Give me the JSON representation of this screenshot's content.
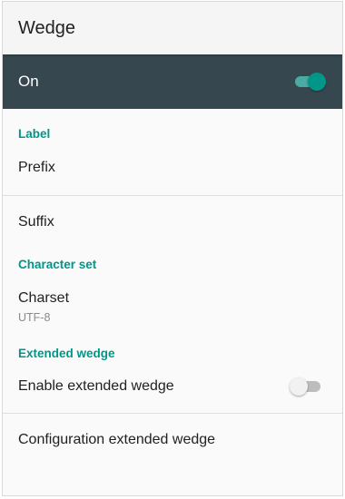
{
  "app_bar": {
    "title": "Wedge"
  },
  "master_switch": {
    "label": "On",
    "checked": true,
    "bar_color": "#37474f",
    "accent_color": "#009688"
  },
  "sections": {
    "label": {
      "header": "Label",
      "prefix": {
        "title": "Prefix"
      },
      "suffix": {
        "title": "Suffix"
      }
    },
    "character_set": {
      "header": "Character set",
      "charset": {
        "title": "Charset",
        "summary": "UTF-8"
      }
    },
    "extended_wedge": {
      "header": "Extended wedge",
      "enable": {
        "title": "Enable extended wedge",
        "checked": false
      },
      "configuration": {
        "title": "Configuration extended wedge"
      }
    }
  }
}
